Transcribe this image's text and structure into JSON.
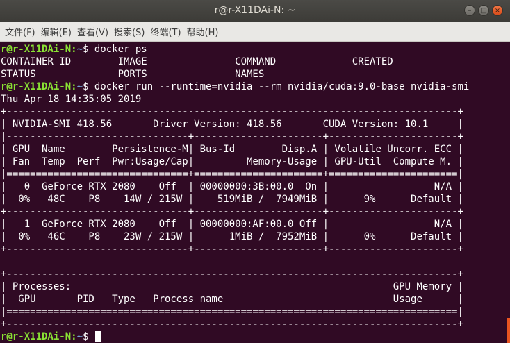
{
  "window": {
    "title": "r@r-X11DAi-N: ~",
    "buttons": {
      "minimize": "–",
      "maximize": "□",
      "close": "×"
    }
  },
  "menu": [
    "文件(F)",
    "编辑(E)",
    "查看(V)",
    "搜索(S)",
    "终端(T)",
    "帮助(H)"
  ],
  "prompt": {
    "user": "r@r-X11DAi-N:",
    "path": "~",
    "symbol": "$ "
  },
  "terminal": {
    "lines": [
      {
        "type": "prompt",
        "cmd": "docker ps"
      },
      {
        "type": "out",
        "text": "CONTAINER ID        IMAGE               COMMAND             CREATED"
      },
      {
        "type": "out",
        "text": "STATUS              PORTS               NAMES"
      },
      {
        "type": "prompt",
        "cmd": "docker run --runtime=nvidia --rm nvidia/cuda:9.0-base nvidia-smi"
      },
      {
        "type": "out",
        "text": "Thu Apr 18 14:35:05 2019"
      },
      {
        "type": "out",
        "text": "+-----------------------------------------------------------------------------+"
      },
      {
        "type": "out",
        "text": "| NVIDIA-SMI 418.56       Driver Version: 418.56       CUDA Version: 10.1     |"
      },
      {
        "type": "out",
        "text": "|-------------------------------+----------------------+----------------------+"
      },
      {
        "type": "out",
        "text": "| GPU  Name        Persistence-M| Bus-Id        Disp.A | Volatile Uncorr. ECC |"
      },
      {
        "type": "out",
        "text": "| Fan  Temp  Perf  Pwr:Usage/Cap|         Memory-Usage | GPU-Util  Compute M. |"
      },
      {
        "type": "out",
        "text": "|===============================+======================+======================|"
      },
      {
        "type": "out",
        "text": "|   0  GeForce RTX 2080    Off  | 00000000:3B:00.0  On |                  N/A |"
      },
      {
        "type": "out",
        "text": "|  0%   48C    P8    14W / 215W |    519MiB /  7949MiB |      9%      Default |"
      },
      {
        "type": "out",
        "text": "+-------------------------------+----------------------+----------------------+"
      },
      {
        "type": "out",
        "text": "|   1  GeForce RTX 2080    Off  | 00000000:AF:00.0 Off |                  N/A |"
      },
      {
        "type": "out",
        "text": "|  0%   46C    P8    23W / 215W |      1MiB /  7952MiB |      0%      Default |"
      },
      {
        "type": "out",
        "text": "+-------------------------------+----------------------+----------------------+"
      },
      {
        "type": "out",
        "text": ""
      },
      {
        "type": "out",
        "text": "+-----------------------------------------------------------------------------+"
      },
      {
        "type": "out",
        "text": "| Processes:                                                       GPU Memory |"
      },
      {
        "type": "out",
        "text": "|  GPU       PID   Type   Process name                             Usage      |"
      },
      {
        "type": "out",
        "text": "|=============================================================================|"
      },
      {
        "type": "out",
        "text": "+-----------------------------------------------------------------------------+"
      },
      {
        "type": "prompt",
        "cmd": "",
        "cursor": true
      }
    ]
  }
}
